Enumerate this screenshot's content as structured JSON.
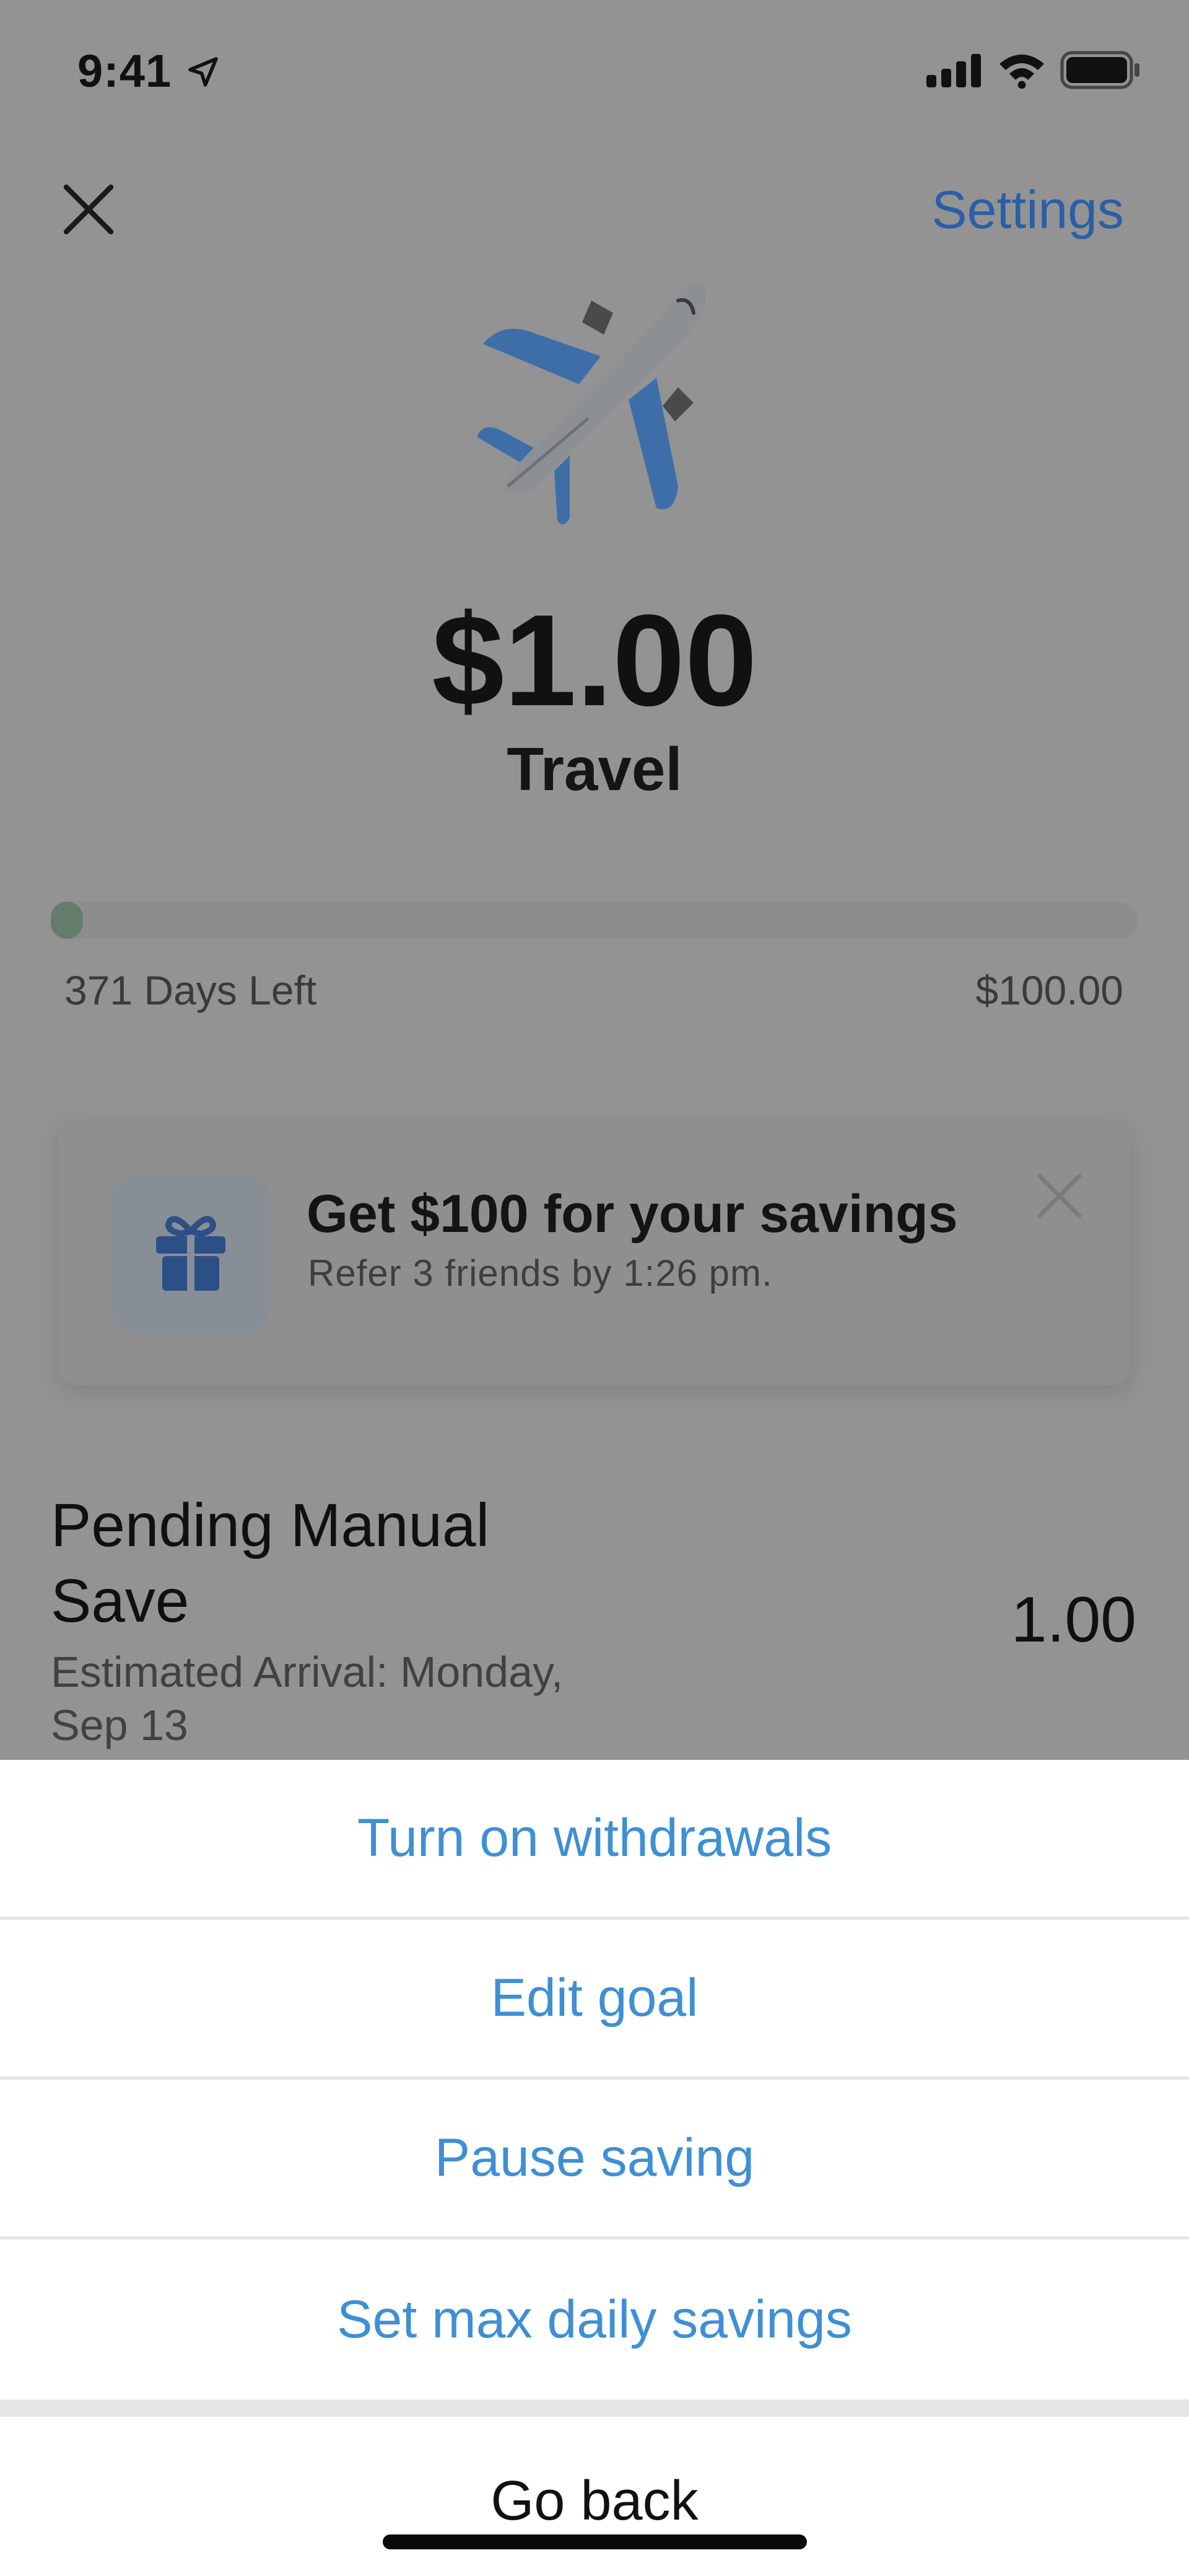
{
  "status_bar": {
    "time": "9:41"
  },
  "header": {
    "settings_label": "Settings"
  },
  "goal": {
    "icon": "airplane-icon",
    "amount": "$1.00",
    "name": "Travel",
    "progress_fraction": 0.01,
    "days_left": "371 Days Left",
    "target": "$100.00"
  },
  "promo": {
    "icon": "gift-icon",
    "title": "Get $100 for your savings",
    "subtitle": "Refer 3 friends by 1:26 pm."
  },
  "pending": {
    "title": "Pending Manual Save",
    "amount": "1.00",
    "eta": "Estimated Arrival: Monday, Sep 13"
  },
  "action_sheet": {
    "actions": [
      {
        "label": "Turn on withdrawals"
      },
      {
        "label": "Edit goal"
      },
      {
        "label": "Pause saving"
      },
      {
        "label": "Set max daily savings"
      }
    ],
    "cancel_label": "Go back"
  },
  "colors": {
    "accent": "#3f8fd4",
    "settings_link": "#2a5fa7",
    "dim_overlay": "#939393",
    "progress_fill": "#637c6c"
  }
}
